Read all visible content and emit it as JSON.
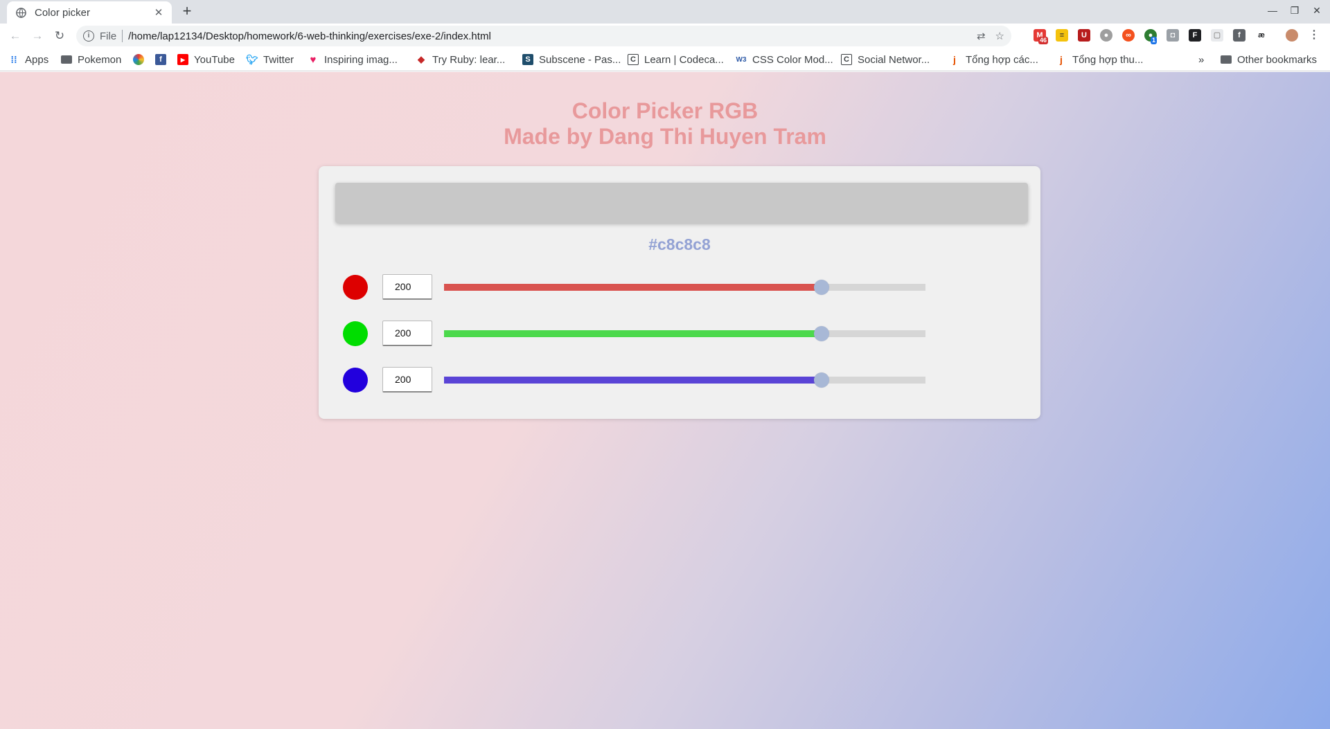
{
  "browser": {
    "tab_title": "Color picker",
    "file_label": "File",
    "url": "/home/lap12134/Desktop/homework/6-web-thinking/exercises/exe-2/index.html",
    "extension_badges": {
      "mail": "46",
      "profile": "1"
    },
    "bookmarks": [
      {
        "label": "Apps",
        "icon": "apps-grid-icon"
      },
      {
        "label": "Pokemon",
        "icon": "folder-icon"
      },
      {
        "label": "",
        "icon": "color-wheel-icon"
      },
      {
        "label": "",
        "icon": "facebook-icon"
      },
      {
        "label": "YouTube",
        "icon": "youtube-icon"
      },
      {
        "label": "Twitter",
        "icon": "twitter-icon"
      },
      {
        "label": "Inspiring imag...",
        "icon": "heart-icon"
      },
      {
        "label": "Try Ruby: lear...",
        "icon": "ruby-icon"
      },
      {
        "label": "Subscene - Pas...",
        "icon": "subscene-icon"
      },
      {
        "label": "Learn | Codeca...",
        "icon": "codecademy-icon"
      },
      {
        "label": "CSS Color Mod...",
        "icon": "w3-icon"
      },
      {
        "label": "Social Networ...",
        "icon": "codecademy-icon"
      },
      {
        "label": "Tổng hợp các...",
        "icon": "j-icon"
      },
      {
        "label": "Tổng hợp thu...",
        "icon": "j-icon"
      }
    ],
    "overflow_label": "»",
    "other_bookmarks": "Other bookmarks"
  },
  "page": {
    "title_line1": "Color Picker RGB",
    "title_line2": "Made by Dang Thi Huyen Tram",
    "hex": "#c8c8c8",
    "preview_color": "#c8c8c8",
    "channels": [
      {
        "name": "red",
        "value": "200",
        "level": 0.784,
        "dot_color": "#dd0000",
        "fill_color": "#d9534f"
      },
      {
        "name": "green",
        "value": "200",
        "level": 0.784,
        "dot_color": "#00dd00",
        "fill_color": "#4cd94c"
      },
      {
        "name": "blue",
        "value": "200",
        "level": 0.784,
        "dot_color": "#2200dd",
        "fill_color": "#5a44d6"
      }
    ]
  }
}
